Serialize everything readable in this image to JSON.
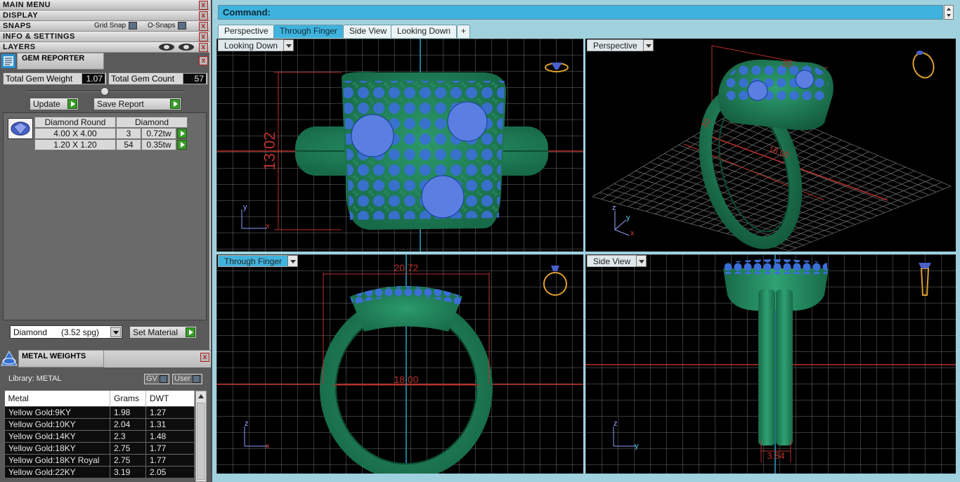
{
  "menus": {
    "main_menu": "MAIN MENU",
    "display": "DISPLAY",
    "snaps": "SNAPS",
    "grid_snap": "Grid Snap",
    "o_snaps": "O-Snaps",
    "info_settings": "INFO & SETTINGS",
    "layers": "LAYERS",
    "close_glyph": "x"
  },
  "gem_reporter": {
    "title": "GEM REPORTER",
    "total_weight_label": "Total Gem Weight",
    "total_weight_value": "1.07",
    "total_count_label": "Total Gem Count",
    "total_count_value": "57",
    "update_button": "Update",
    "save_report_button": "Save Report",
    "table_header_cut": "Diamond Round",
    "table_header_material": "Diamond",
    "rows": [
      {
        "size": "4.00 X 4.00",
        "count": "3",
        "weight": "0.72tw"
      },
      {
        "size": "1.20 X 1.20",
        "count": "54",
        "weight": "0.35tw"
      }
    ],
    "material_select": "Diamond      (3.52 spg)",
    "set_material_button": "Set Material"
  },
  "metal_weights": {
    "title": "METAL WEIGHTS",
    "library": "Library: METAL",
    "gv_button": "GV",
    "user_button": "User",
    "columns": [
      "Metal",
      "Grams",
      "DWT"
    ],
    "rows": [
      [
        "Yellow Gold:9KY",
        "1.98",
        "1.27"
      ],
      [
        "Yellow Gold:10KY",
        "2.04",
        "1.31"
      ],
      [
        "Yellow Gold:14KY",
        "2.3",
        "1.48"
      ],
      [
        "Yellow Gold:18KY",
        "2.75",
        "1.77"
      ],
      [
        "Yellow Gold:18KY Royal",
        "2.75",
        "1.77"
      ],
      [
        "Yellow Gold:22KY",
        "3.19",
        "2.05"
      ]
    ]
  },
  "command": {
    "label": "Command:"
  },
  "view_tabs": [
    "Perspective",
    "Through Finger",
    "Side View",
    "Looking Down"
  ],
  "add_tab_glyph": "+",
  "viewports": {
    "top_left": {
      "label": "Looking Down",
      "dimension": "13.02",
      "axis_h": "x",
      "axis_v": "y"
    },
    "top_right": {
      "label": "Perspective",
      "dimension_a": "20.",
      "dimension_b": "18.00",
      "dimension_c": "10",
      "axis_a": "z",
      "axis_b": "y",
      "axis_c": "x"
    },
    "bottom_left": {
      "label": "Through Finger",
      "dimension_top": "20.72",
      "dimension_mid": "18.00",
      "axis_h": "x",
      "axis_v": "z"
    },
    "bottom_right": {
      "label": "Side View",
      "dimension_bottom": "3.84",
      "axis_h": "y",
      "axis_v": "z"
    }
  },
  "colors": {
    "metal_green": "#1f8a5e",
    "gem_blue": "#3b6fd8",
    "grid": "#6e6e6e",
    "dimension_red": "#b8302a",
    "command_blue": "#3fb3dd"
  }
}
